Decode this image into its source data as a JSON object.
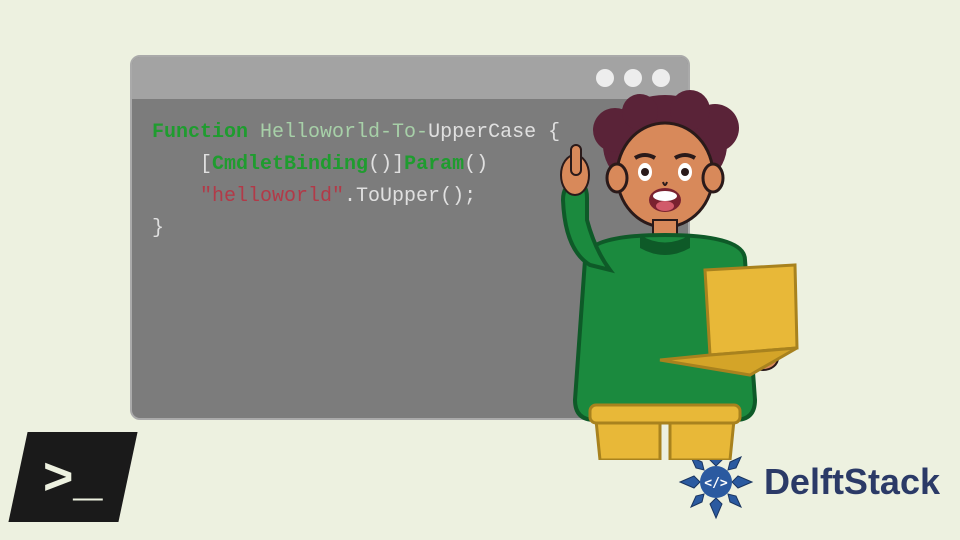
{
  "code": {
    "keyword_function": "Function",
    "func_name": "Helloworld-To-",
    "func_name_suffix": "UpperCase {",
    "attr_open": "[",
    "attr_name": "CmdletBinding",
    "attr_close": "()]",
    "param_keyword": "Param",
    "param_close": "()",
    "string_literal": "\"helloworld\"",
    "method_call": ".ToUpper();",
    "closing_brace": "}"
  },
  "powershell_logo": ">_",
  "delftstack_label": "DelftStack",
  "icons": {
    "window_dot": "window-control-dot",
    "ps": "powershell-icon",
    "delft": "delftstack-icon",
    "character": "person-with-laptop-illustration"
  }
}
